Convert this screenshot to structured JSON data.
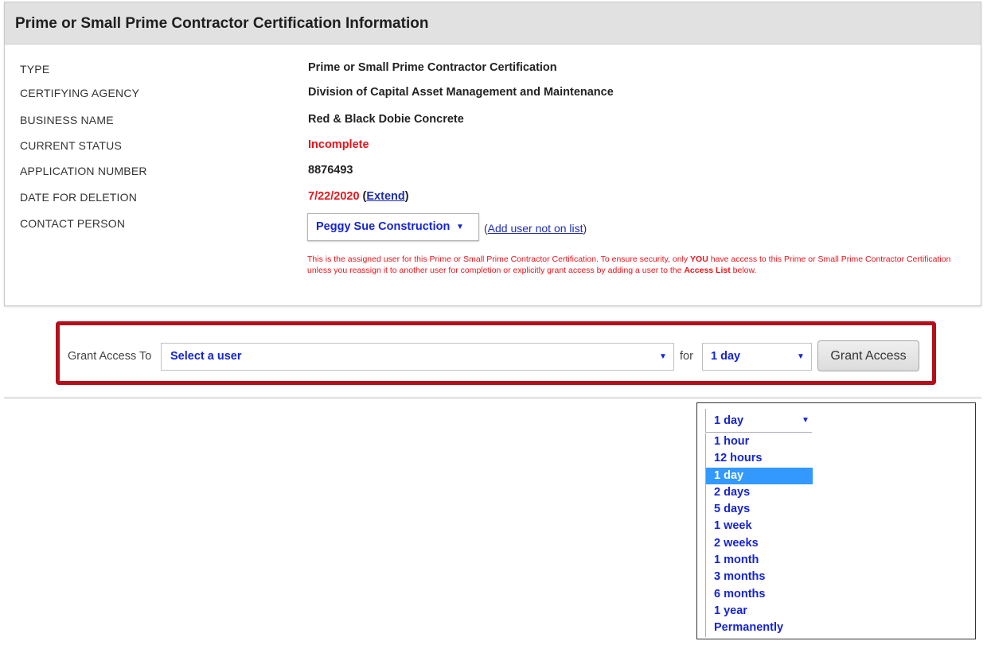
{
  "panel": {
    "title": "Prime or Small Prime Contractor Certification Information",
    "fields": {
      "type": {
        "label": "TYPE",
        "value": "Prime or Small Prime Contractor Certification"
      },
      "agency": {
        "label": "CERTIFYING AGENCY",
        "value": "Division of Capital Asset Management and Maintenance"
      },
      "business": {
        "label": "BUSINESS NAME",
        "value": "Red & Black Dobie Concrete"
      },
      "status": {
        "label": "CURRENT STATUS",
        "value": "Incomplete"
      },
      "appnum": {
        "label": "APPLICATION NUMBER",
        "value": "8876493"
      },
      "deletion": {
        "label": "DATE FOR DELETION",
        "value": "7/22/2020",
        "extend_link": "Extend",
        "open_paren": "(",
        "close_paren": ")"
      },
      "contact": {
        "label": "CONTACT PERSON",
        "selected": "Peggy Sue Construction",
        "add_link": "Add user not on list",
        "open_paren": "(",
        "close_paren": ")"
      }
    },
    "note": {
      "part1": "This is the assigned user for this Prime or Small Prime Contractor Certification. To ensure security, only ",
      "emph1": "YOU",
      "part2": " have access to this Prime or Small Prime Contractor Certification unless you reassign it to another user for completion or explicitly grant access by adding a user to the ",
      "emph2": "Access List",
      "part3": " below."
    }
  },
  "grant": {
    "label": "Grant Access To",
    "user_select": "Select a user",
    "for_label": "for",
    "duration_select": "1 day",
    "button": "Grant Access"
  },
  "duration_dropdown": {
    "current": "1 day",
    "options": [
      "1 hour",
      "12 hours",
      "1 day",
      "2 days",
      "5 days",
      "1 week",
      "2 weeks",
      "1 month",
      "3 months",
      "6 months",
      "1 year",
      "Permanently"
    ],
    "highlighted": "1 day"
  },
  "icons": {
    "caret": "caret-down-icon"
  },
  "colors": {
    "accent_red": "#e8141b",
    "link_blue": "#1524d4",
    "frame_red": "#b50f1c",
    "highlight": "#3399ff"
  }
}
